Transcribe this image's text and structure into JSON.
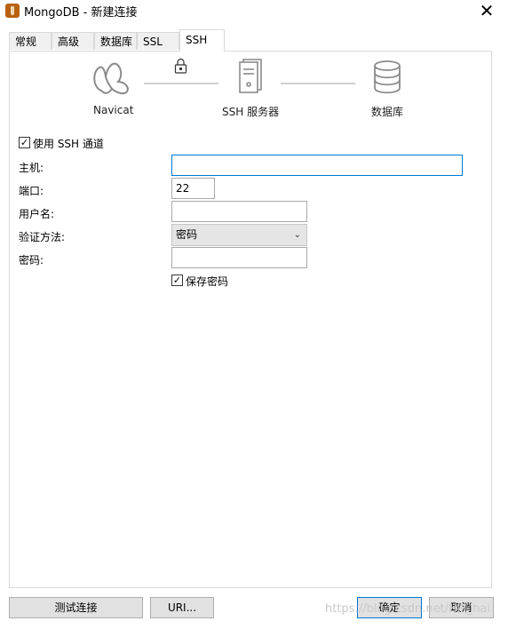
{
  "window": {
    "title": "MongoDB - 新建连接",
    "close_glyph": "✕"
  },
  "tabs": [
    {
      "label": "常规"
    },
    {
      "label": "高级"
    },
    {
      "label": "数据库"
    },
    {
      "label": "SSL"
    },
    {
      "label": "SSH",
      "active": true
    }
  ],
  "diagram": {
    "client_label": "Navicat",
    "server_label": "SSH 服务器",
    "database_label": "数据库",
    "icons": [
      "navicat-icon",
      "lock-icon",
      "server-icon",
      "database-icon"
    ]
  },
  "form": {
    "use_ssh_label": "使用 SSH 通道",
    "use_ssh_checked": true,
    "host_label": "主机:",
    "host_value": "",
    "port_label": "端口:",
    "port_value": "22",
    "username_label": "用户名:",
    "username_value": "",
    "auth_label": "验证方法:",
    "auth_value": "密码",
    "password_label": "密码:",
    "password_value": "",
    "save_password_label": "保存密码",
    "save_password_checked": true
  },
  "buttons": {
    "test": "测试连接",
    "uri": "URI...",
    "ok": "确定",
    "cancel": "取消"
  },
  "watermark": "https://blog.csdn.net/Hill_hai",
  "colors": {
    "accent": "#0078d7",
    "app_icon": "#b8620f",
    "icon_gray": "#8a8a8a"
  }
}
